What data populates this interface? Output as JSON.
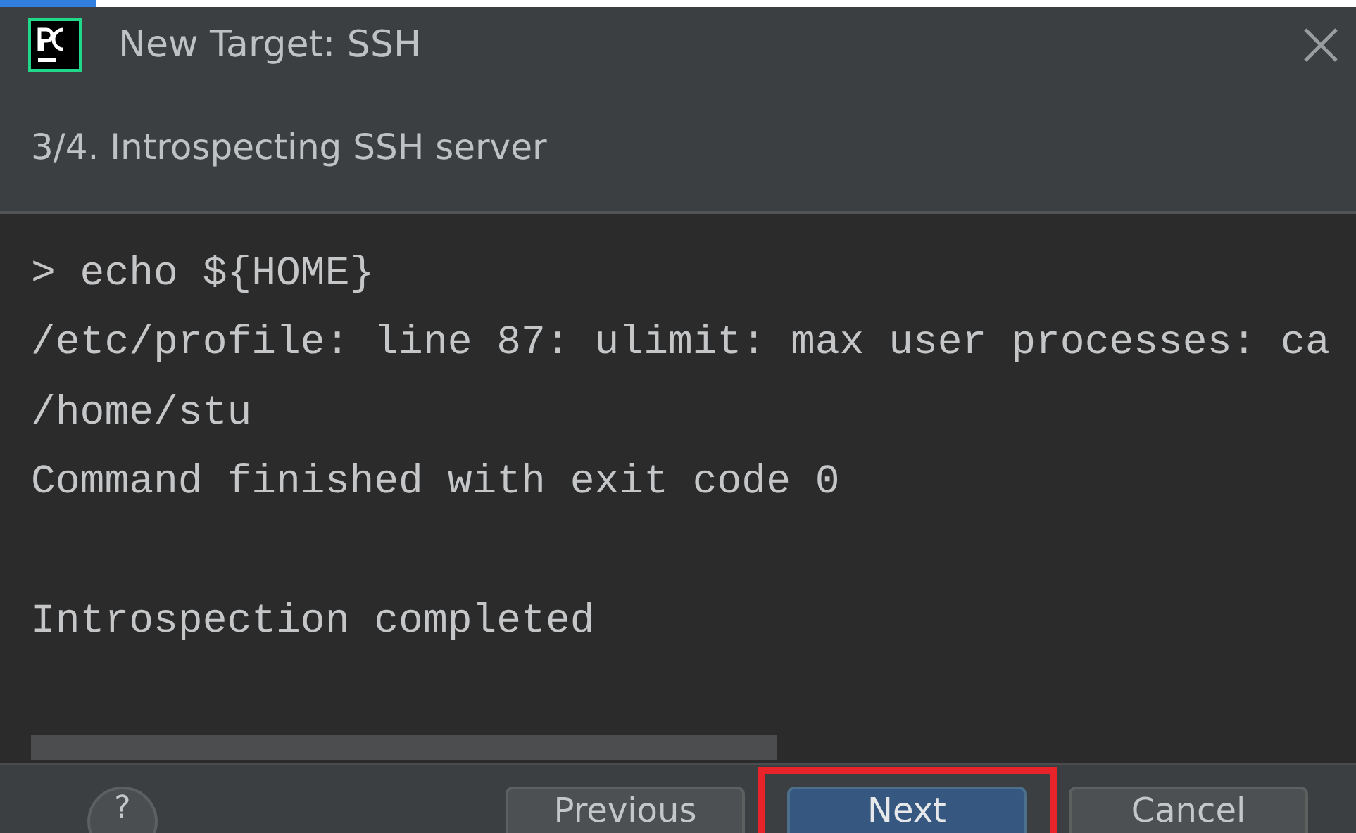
{
  "window": {
    "title": "New Target: SSH"
  },
  "step": {
    "label": "3/4. Introspecting SSH server"
  },
  "console": {
    "lines": [
      "> echo ${HOME}",
      "/etc/profile: line 87: ulimit: max user processes: ca",
      "/home/stu",
      "Command finished with exit code 0"
    ],
    "status": "Introspection completed"
  },
  "footer": {
    "help": "?",
    "buttons": [
      {
        "label": "Previous",
        "kind": "secondary",
        "highlighted": false
      },
      {
        "label": "Next",
        "kind": "primary",
        "highlighted": true
      },
      {
        "label": "Cancel",
        "kind": "secondary",
        "highlighted": false
      }
    ]
  }
}
